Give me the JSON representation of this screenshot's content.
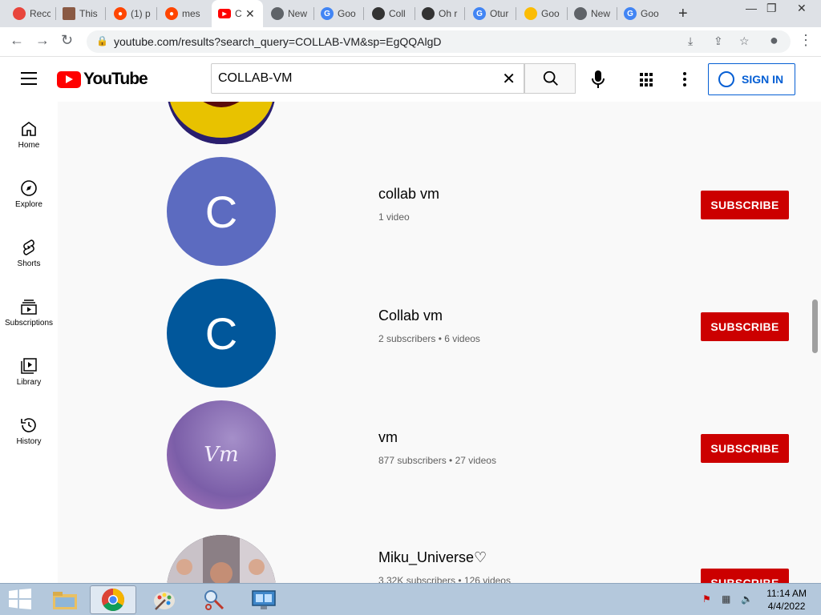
{
  "browser": {
    "tabs": [
      {
        "title": "Recc",
        "icon": "chrome-favicon",
        "color": "#e8453c"
      },
      {
        "title": "This",
        "icon": "user-photo-favicon",
        "color": "#8a5a44"
      },
      {
        "title": "(1) p",
        "icon": "reddit-favicon",
        "color": "#ff4500"
      },
      {
        "title": "mes",
        "icon": "reddit-favicon",
        "color": "#ff4500"
      },
      {
        "title": "C",
        "icon": "youtube-favicon",
        "color": "#ff0000",
        "active": true
      },
      {
        "title": "New",
        "icon": "chrome-favicon",
        "color": "#5f6368"
      },
      {
        "title": "Goo",
        "icon": "google-favicon",
        "color": "#4285f4"
      },
      {
        "title": "Coll",
        "icon": "collabvm-favicon",
        "color": "#333333"
      },
      {
        "title": "Oh r",
        "icon": "collabvm-favicon",
        "color": "#333333"
      },
      {
        "title": "Otur",
        "icon": "google-favicon",
        "color": "#4285f4"
      },
      {
        "title": "Goo",
        "icon": "google-photos-favicon",
        "color": "#fbbc04"
      },
      {
        "title": "New",
        "icon": "chrome-favicon",
        "color": "#5f6368"
      },
      {
        "title": "Goo",
        "icon": "google-favicon",
        "color": "#4285f4"
      }
    ],
    "url": "youtube.com/results?search_query=COLLAB-VM&sp=EgQQAlgD"
  },
  "youtube": {
    "logo_text": "YouTube",
    "search_value": "COLLAB-VM",
    "signin_label": "SIGN IN",
    "sidebar": [
      {
        "label": "Home",
        "icon": "home-icon"
      },
      {
        "label": "Explore",
        "icon": "compass-icon"
      },
      {
        "label": "Shorts",
        "icon": "shorts-icon"
      },
      {
        "label": "Subscriptions",
        "icon": "subscriptions-icon"
      },
      {
        "label": "Library",
        "icon": "library-icon"
      },
      {
        "label": "History",
        "icon": "history-icon"
      }
    ],
    "channels": [
      {
        "name": "",
        "meta": "",
        "avatar_letter": "",
        "avatar_color": "#2a1e6e",
        "subscribe": ""
      },
      {
        "name": "collab vm",
        "meta": "1 video",
        "avatar_letter": "C",
        "avatar_color": "#5c6bc0",
        "subscribe": "SUBSCRIBE"
      },
      {
        "name": "Collab vm",
        "meta": "2 subscribers • 6 videos",
        "avatar_letter": "C",
        "avatar_color": "#01579b",
        "subscribe": "SUBSCRIBE"
      },
      {
        "name": "vm",
        "meta": "877 subscribers • 27 videos",
        "avatar_letter": "",
        "avatar_color": "#8a6aa8",
        "avatar_script": "Vm",
        "subscribe": "SUBSCRIBE"
      },
      {
        "name": "Miku_Universe♡",
        "meta": "3.32K subscribers • 126 videos",
        "avatar_letter": "",
        "avatar_color": "#3a3a48",
        "subscribe": "SUBSCRIBE"
      }
    ]
  },
  "taskbar": {
    "time": "11:14 AM",
    "date": "4/4/2022"
  },
  "colors": {
    "subscribe_red": "#cc0000",
    "link_blue": "#065fd4"
  }
}
